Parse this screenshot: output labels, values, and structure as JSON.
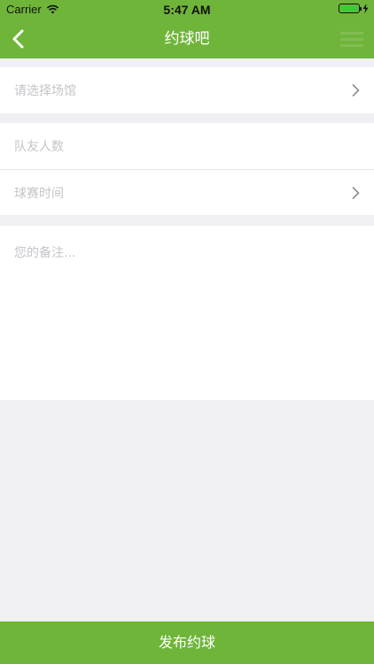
{
  "status_bar": {
    "carrier": "Carrier",
    "time": "5:47 AM",
    "battery_level": 1.0,
    "icons": [
      "wifi-icon",
      "battery-icon",
      "charging-icon"
    ]
  },
  "nav": {
    "title": "约球吧",
    "back_icon": "chevron-left-icon"
  },
  "form": {
    "venue_placeholder": "请选择场馆",
    "teammates_placeholder": "队友人数",
    "time_placeholder": "球赛时间",
    "notes_placeholder": "您的备注..."
  },
  "submit_label": "发布约球",
  "colors": {
    "brand_green": "#6fb53a",
    "background": "#efeff4",
    "placeholder": "#c4c4c9",
    "chevron": "#8e8e93"
  }
}
